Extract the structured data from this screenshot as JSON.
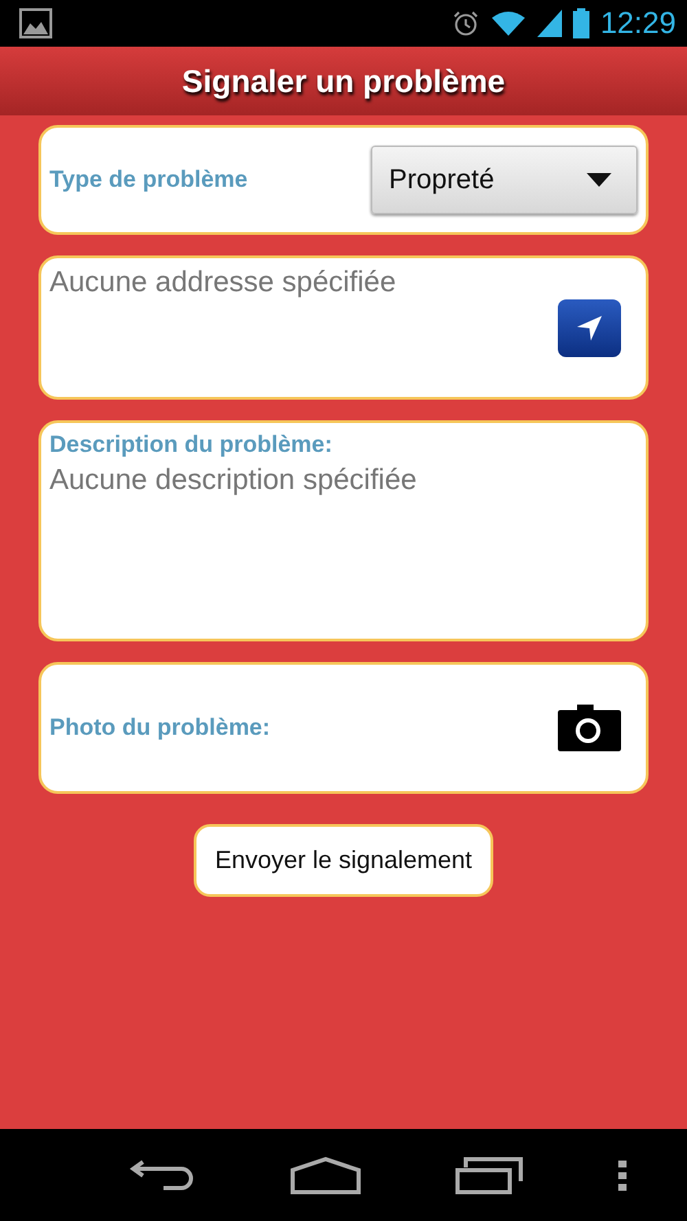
{
  "status_bar": {
    "time": "12:29"
  },
  "header": {
    "title": "Signaler un problème"
  },
  "type_card": {
    "label": "Type de problème",
    "value": "Propreté"
  },
  "address": {
    "placeholder": "Aucune addresse spécifiée"
  },
  "description": {
    "label": "Description du problème:",
    "placeholder": "Aucune description spécifiée"
  },
  "photo": {
    "label": "Photo du problème:"
  },
  "submit_button": "Envoyer le signalement"
}
